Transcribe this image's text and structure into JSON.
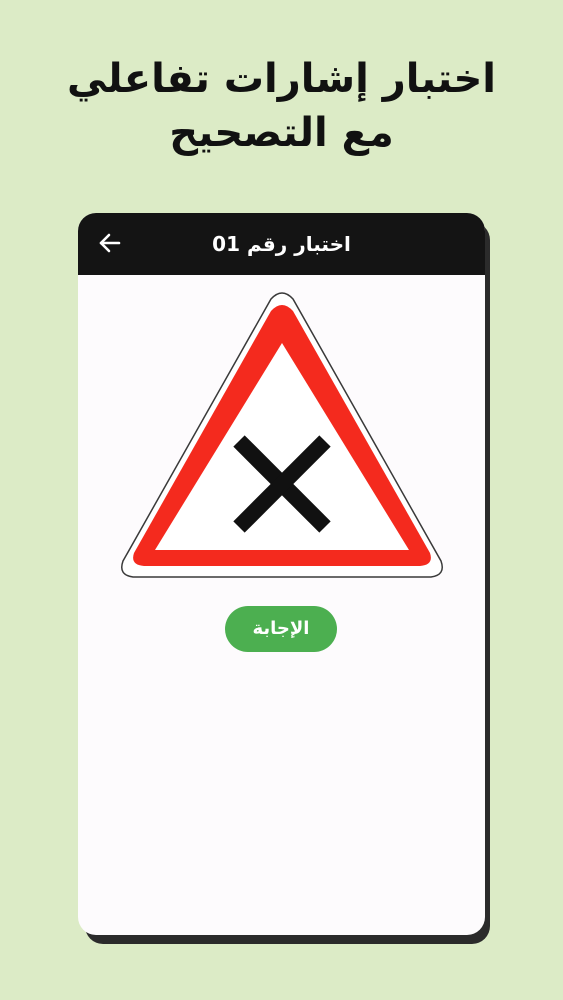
{
  "headline": {
    "line1": "اختبار إشارات تفاعلي",
    "line2": "مع التصحيح"
  },
  "screen": {
    "title": "اختبار رقم 01",
    "back_icon": "arrow-left-icon",
    "sign_icon": "intersection-priority-right-warning-sign",
    "answer_button_label": "الإجابة"
  },
  "colors": {
    "page_background": "#dcebc6",
    "app_bar": "#141414",
    "screen_background": "#fdfbfd",
    "sign_red": "#f42a1e",
    "answer_button": "#4caf50"
  }
}
